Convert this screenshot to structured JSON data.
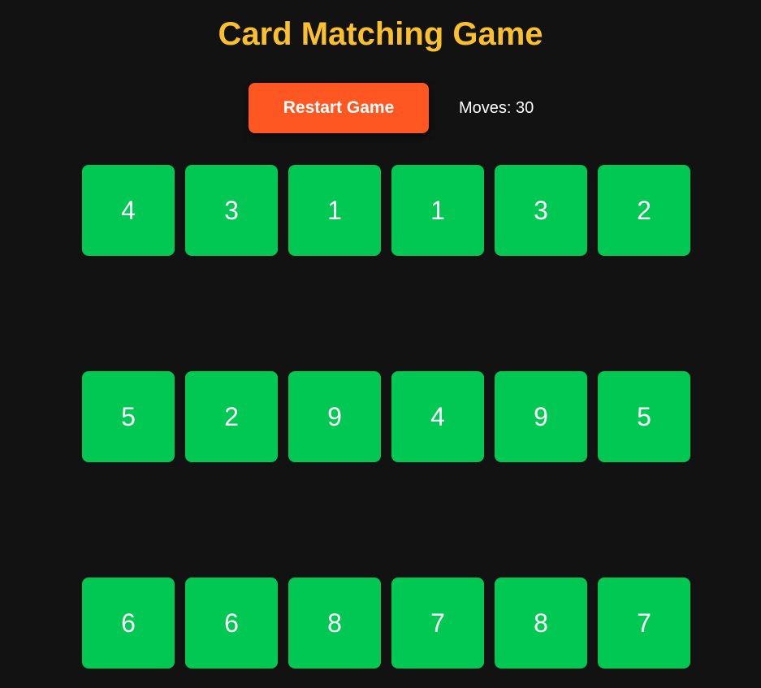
{
  "title": "Card Matching Game",
  "controls": {
    "restart_label": "Restart Game",
    "moves_label": "Moves:",
    "moves_count": "30"
  },
  "colors": {
    "background": "#121212",
    "title": "#fbc02d",
    "restart_button": "#ff5722",
    "card": "#00c853",
    "text": "#ffffff"
  },
  "cards": [
    "4",
    "3",
    "1",
    "1",
    "3",
    "2",
    "5",
    "2",
    "9",
    "4",
    "9",
    "5",
    "6",
    "6",
    "8",
    "7",
    "8",
    "7"
  ]
}
